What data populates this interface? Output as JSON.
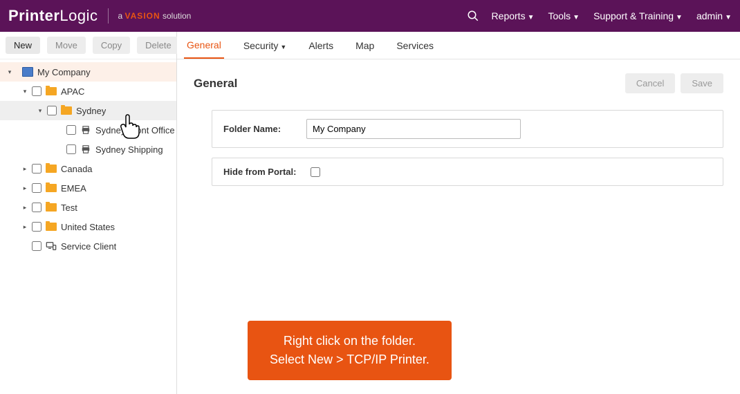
{
  "header": {
    "logo_printer": "Printer",
    "logo_logic": "Logic",
    "tagline_prefix": "a ",
    "tagline_brand": "VASION",
    "tagline_suffix": " solution",
    "menu": {
      "reports": "Reports",
      "tools": "Tools",
      "support": "Support & Training",
      "admin": "admin"
    }
  },
  "toolbar": {
    "new": "New",
    "move": "Move",
    "copy": "Copy",
    "delete": "Delete"
  },
  "tree": {
    "root": "My Company",
    "apac": "APAC",
    "sydney": "Sydney",
    "sydney_front": "Sydney Front Office",
    "sydney_front_truncated": "Syd              nt Office",
    "sydney_shipping": "Sydney Shipping",
    "canada": "Canada",
    "emea": "EMEA",
    "test": "Test",
    "us": "United States",
    "service_client": "Service Client"
  },
  "tabs": {
    "general": "General",
    "security": "Security",
    "alerts": "Alerts",
    "map": "Map",
    "services": "Services"
  },
  "content": {
    "title": "General",
    "cancel": "Cancel",
    "save": "Save",
    "folder_name_label": "Folder Name:",
    "folder_name_value": "My Company",
    "hide_label": "Hide from Portal:"
  },
  "tooltip": {
    "line1": "Right click on the folder.",
    "line2": "Select New > TCP/IP Printer."
  }
}
